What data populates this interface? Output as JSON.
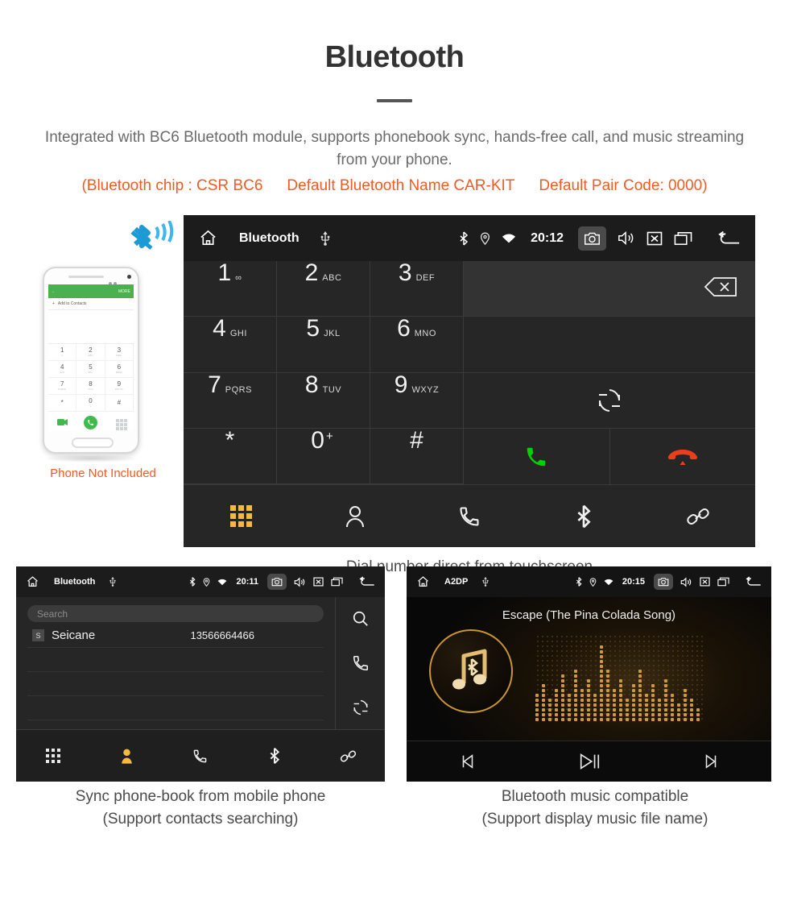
{
  "header": {
    "title": "Bluetooth",
    "subtitle": "Integrated with BC6 Bluetooth module, supports phonebook sync, hands-free call, and music streaming from your phone.",
    "spec_1": "(Bluetooth chip : CSR BC6",
    "spec_2": "Default Bluetooth Name CAR-KIT",
    "spec_3": "Default Pair Code: 0000)",
    "spec_color": "#F15A22",
    "title_color": "#333333",
    "subtitle_color": "#6a6a6a"
  },
  "phone_mock": {
    "appbar_back": "←",
    "appbar_more": "MORE",
    "add_contacts_plus": "+",
    "add_contacts_label": "Add to Contacts",
    "keys": [
      {
        "num": "1",
        "sub": "∞"
      },
      {
        "num": "2",
        "sub": "ABC"
      },
      {
        "num": "3",
        "sub": "DEF"
      },
      {
        "num": "4",
        "sub": "GHI"
      },
      {
        "num": "5",
        "sub": "JKL"
      },
      {
        "num": "6",
        "sub": "MNO"
      },
      {
        "num": "7",
        "sub": "PQRS"
      },
      {
        "num": "8",
        "sub": "TUV"
      },
      {
        "num": "9",
        "sub": "WXYZ"
      },
      {
        "num": "*",
        "sub": ""
      },
      {
        "num": "0",
        "sub": "+"
      },
      {
        "num": "#",
        "sub": ""
      }
    ],
    "note": "Phone Not Included",
    "note_color": "#F15A22",
    "bluetooth_icon": "bluetooth-signal-icon",
    "accent_color": "#4CAF50"
  },
  "dialer": {
    "statusbar": {
      "home_icon": "home-icon",
      "title": "Bluetooth",
      "usb_icon": "usb-icon",
      "bluetooth_icon": "bluetooth-icon",
      "location_icon": "location-pin-icon",
      "wifi_icon": "wifi-icon",
      "time": "20:12",
      "camera_icon": "camera-icon",
      "volume_icon": "volume-icon",
      "mute_icon": "mute-box-icon",
      "recents_icon": "recents-icon",
      "back_icon": "back-arrow-icon"
    },
    "keys": [
      {
        "num": "1",
        "sub": "∞",
        "name": "key-1"
      },
      {
        "num": "2",
        "sub": "ABC",
        "name": "key-2"
      },
      {
        "num": "3",
        "sub": "DEF",
        "name": "key-3"
      },
      {
        "num": "4",
        "sub": "GHI",
        "name": "key-4"
      },
      {
        "num": "5",
        "sub": "JKL",
        "name": "key-5"
      },
      {
        "num": "6",
        "sub": "MNO",
        "name": "key-6"
      },
      {
        "num": "7",
        "sub": "PQRS",
        "name": "key-7"
      },
      {
        "num": "8",
        "sub": "TUV",
        "name": "key-8"
      },
      {
        "num": "9",
        "sub": "WXYZ",
        "name": "key-9"
      },
      {
        "num": "*",
        "sub": "",
        "name": "key-star"
      },
      {
        "num": "0",
        "sub": "+",
        "name": "key-0"
      },
      {
        "num": "#",
        "sub": "",
        "name": "key-hash"
      }
    ],
    "number_value": "",
    "backspace_icon": "backspace-icon",
    "sync_icon": "sync-icon",
    "call_icon": "call-icon",
    "hangup_icon": "hangup-icon",
    "call_color": "#00D100",
    "hangup_color": "#E8401C",
    "nav": [
      {
        "icon": "dialpad-icon",
        "active": true
      },
      {
        "icon": "contacts-icon",
        "active": false
      },
      {
        "icon": "call-log-icon",
        "active": false
      },
      {
        "icon": "bluetooth-icon",
        "active": false
      },
      {
        "icon": "link-icon",
        "active": false
      }
    ],
    "active_color": "#F5B942",
    "caption": "Dial number direct from touchscreen"
  },
  "phonebook": {
    "statusbar": {
      "home_icon": "home-icon",
      "title": "Bluetooth",
      "usb_icon": "usb-icon",
      "time": "20:11"
    },
    "search_placeholder": "Search",
    "search_value": "",
    "contacts": [
      {
        "initial": "S",
        "name": "Seicane",
        "number": "13566664466"
      }
    ],
    "empty_rows": 3,
    "side_icons": [
      "search-icon",
      "call-icon",
      "sync-icon"
    ],
    "nav": [
      {
        "icon": "dialpad-icon",
        "active": false
      },
      {
        "icon": "contacts-icon",
        "active": true
      },
      {
        "icon": "call-log-icon",
        "active": false
      },
      {
        "icon": "bluetooth-icon",
        "active": false
      },
      {
        "icon": "link-icon",
        "active": false
      }
    ],
    "caption_line1": "Sync phone-book from mobile phone",
    "caption_line2": "(Support contacts searching)"
  },
  "music": {
    "statusbar": {
      "home_icon": "home-icon",
      "title": "A2DP",
      "usb_icon": "usb-icon",
      "time": "20:15"
    },
    "song_title": "Escape (The Pina Colada Song)",
    "album_icon": "music-note-bluetooth-icon",
    "controls": [
      {
        "icon": "previous-track-icon",
        "glyph": "⏮"
      },
      {
        "icon": "play-pause-icon",
        "glyph": "▶❙"
      },
      {
        "icon": "next-track-icon",
        "glyph": "⏭"
      }
    ],
    "accent_color": "#d49a2a",
    "caption_line1": "Bluetooth music compatible",
    "caption_line2": "(Support display music file name)"
  }
}
